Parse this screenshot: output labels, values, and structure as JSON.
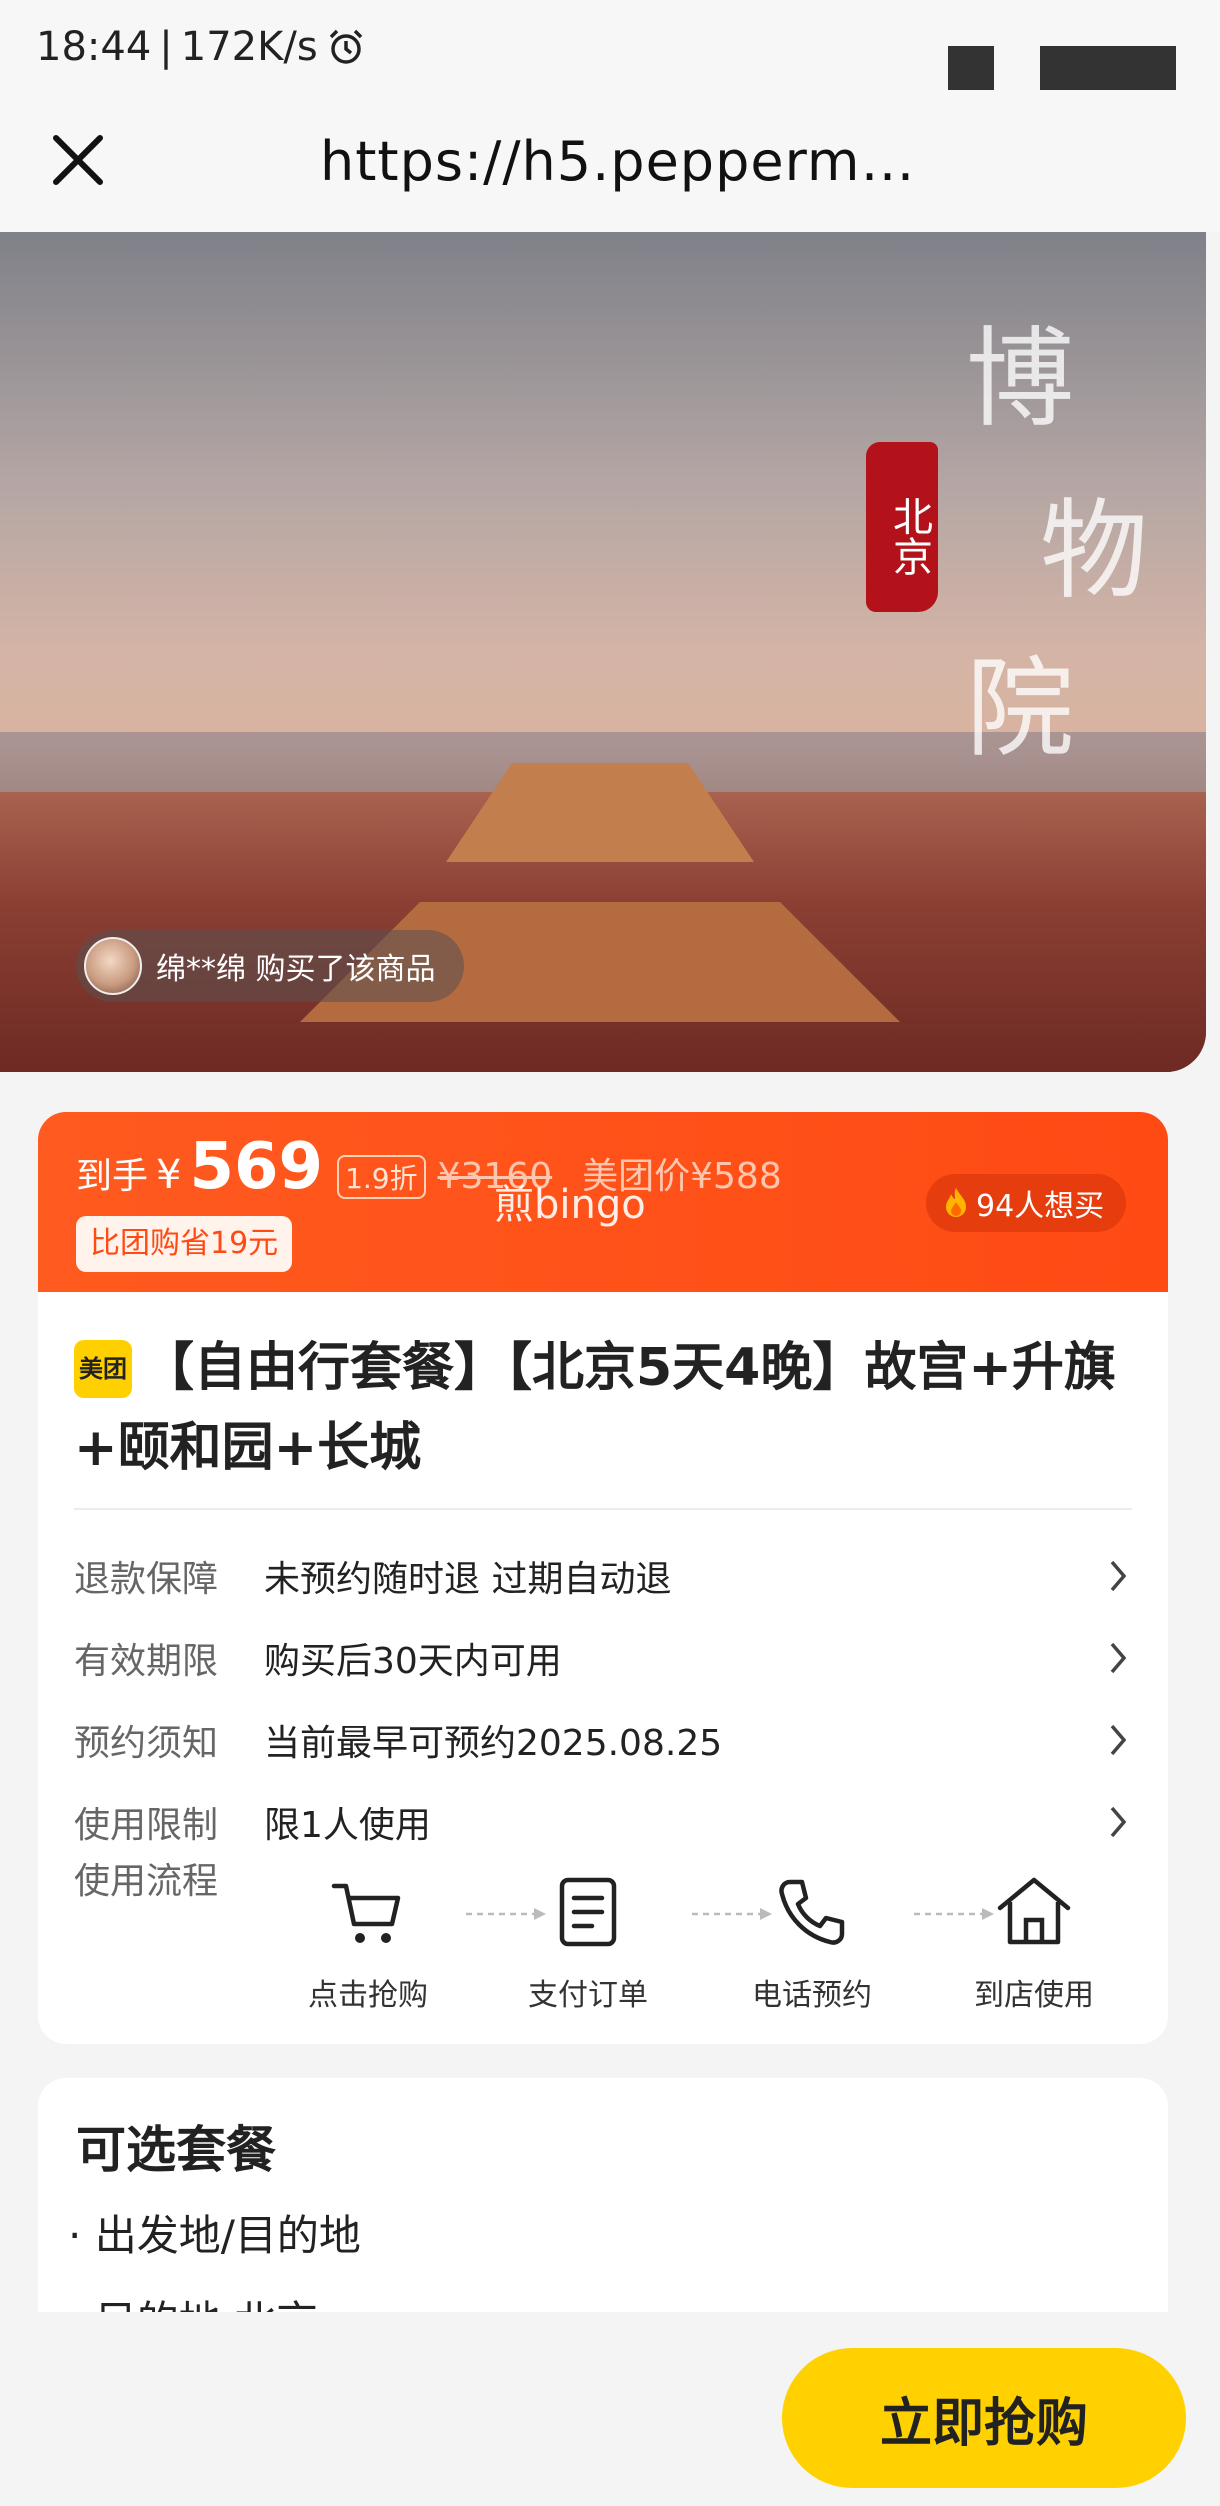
{
  "status_bar": {
    "time": "18:44",
    "speed": "172K/s",
    "separator": "|"
  },
  "url_bar": {
    "url": "https://h5.pepperm…",
    "close_icon": "close-icon"
  },
  "hero": {
    "seal_text": "北京",
    "calligraphy": [
      "博",
      "物",
      "院"
    ],
    "recent_buyer": "绵**绵 购买了该商品"
  },
  "price": {
    "label": "到手",
    "currency": "¥",
    "amount": "569",
    "discount": "1.9折",
    "original": "¥3160",
    "meituan_price": "美团价¥588",
    "savings": "比团购省19元",
    "want_count": "94人想买",
    "watermark": "煎bingo"
  },
  "product": {
    "brand_logo": "美团",
    "title": "【自由行套餐】【北京5天4晚】故宫+升旗+颐和园+长城"
  },
  "info_rows": [
    {
      "key": "退款保障",
      "value": "未预约随时退 过期自动退"
    },
    {
      "key": "有效期限",
      "value": "购买后30天内可用"
    },
    {
      "key": "预约须知",
      "value": "当前最早可预约2025.08.25"
    },
    {
      "key": "使用限制",
      "value": "限1人使用"
    }
  ],
  "flow": {
    "label": "使用流程",
    "steps": [
      {
        "label": "点击抢购",
        "icon": "cart-icon"
      },
      {
        "label": "支付订单",
        "icon": "document-icon"
      },
      {
        "label": "电话预约",
        "icon": "phone-icon"
      },
      {
        "label": "到店使用",
        "icon": "home-icon"
      }
    ]
  },
  "package": {
    "heading": "可选套餐",
    "bullet_1": "出发地/目的地",
    "bullet_2": "目的地 北京"
  },
  "cta": {
    "buy_now": "立即抢购"
  },
  "colors": {
    "accent_orange": "#ff4a14",
    "cta_yellow": "#ffd100",
    "brand_yellow": "#ffd000"
  }
}
